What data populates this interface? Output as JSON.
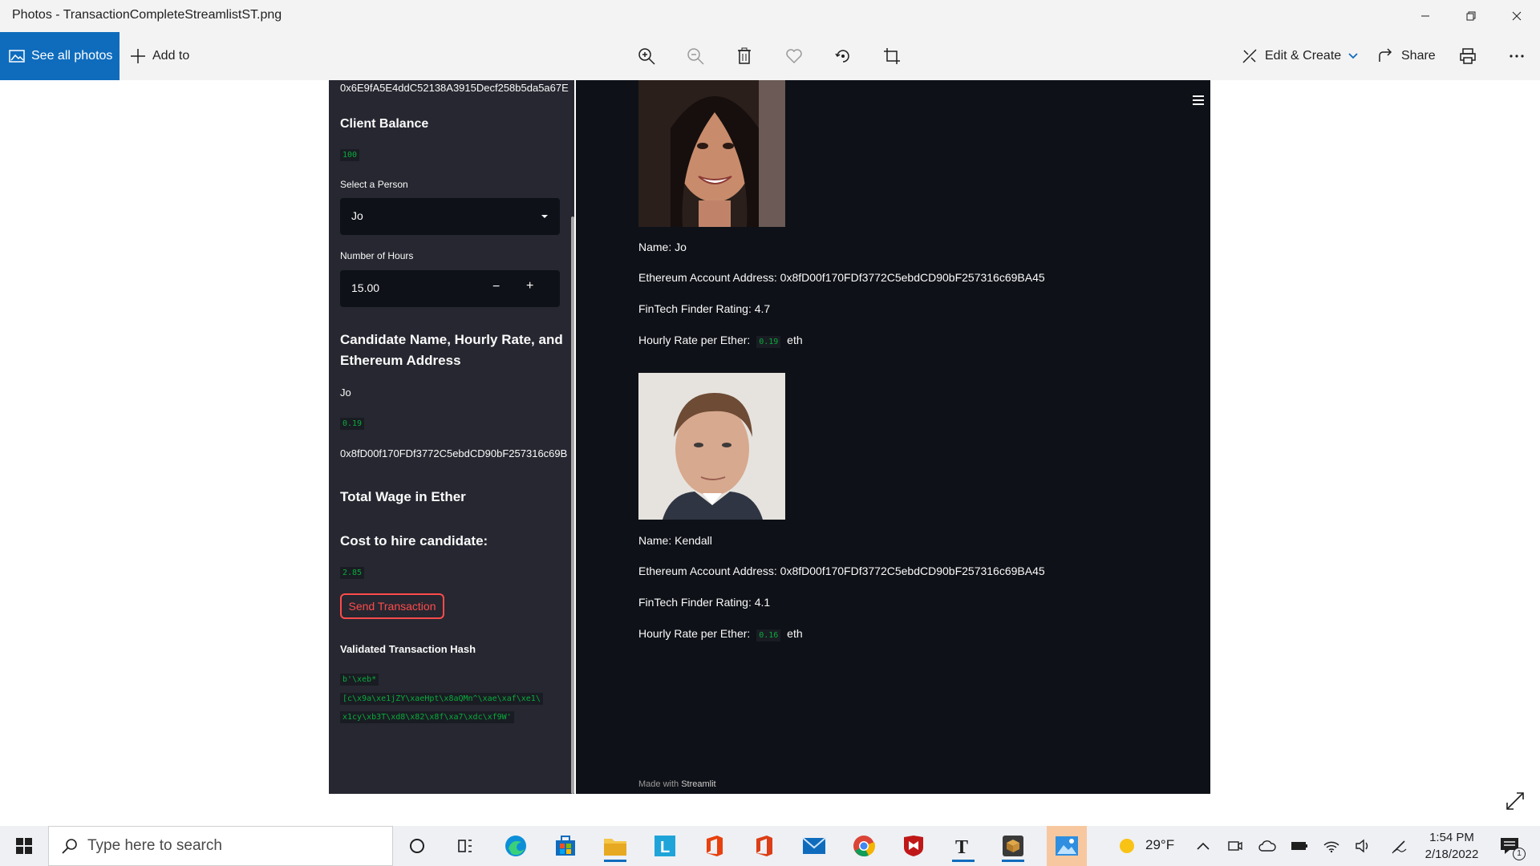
{
  "window": {
    "title": "Photos - TransactionCompleteStreamlistST.png"
  },
  "toolbar": {
    "see_all_photos": "See all photos",
    "add_to": "Add to",
    "edit_create": "Edit & Create",
    "share": "Share"
  },
  "sidebar": {
    "top_address": "0x6E9fA5E4ddC52138A3915Decf258b5da5a67E",
    "client_balance_heading": "Client Balance",
    "client_balance_value": "100",
    "select_person_label": "Select a Person",
    "select_person_value": "Jo",
    "hours_label": "Number of Hours",
    "hours_value": "15.00",
    "minus": "−",
    "plus": "+",
    "candidate_heading_1": "Candidate Name, Hourly Rate, and",
    "candidate_heading_2": "Ethereum Address",
    "candidate_name": "Jo",
    "candidate_rate": "0.19",
    "candidate_address": "0x8fD00f170FDf3772C5ebdCD90bF257316c69B",
    "total_wage_heading": "Total Wage in Ether",
    "cost_heading": "Cost to hire candidate:",
    "cost_value": "2.85",
    "send_button": "Send Transaction",
    "hash_heading": "Validated Transaction Hash",
    "hash_line1": "b'\\xeb*",
    "hash_line2": "[c\\x9a\\xe1jZY\\xaeHpt\\x8aQMn^\\xae\\xaf\\xe1\\",
    "hash_line3": "x1cy\\xb3T\\xd8\\x82\\x8f\\xa7\\xdc\\xf9W'"
  },
  "main": {
    "candidates": [
      {
        "name": "Name: Jo",
        "address": "Ethereum Account Address: 0x8fD00f170FDf3772C5ebdCD90bF257316c69BA45",
        "rating": "FinTech Finder Rating: 4.7",
        "rate_label": "Hourly Rate per Ether:",
        "rate_value": "0.19",
        "rate_unit": "eth"
      },
      {
        "name": "Name: Kendall",
        "address": "Ethereum Account Address: 0x8fD00f170FDf3772C5ebdCD90bF257316c69BA45",
        "rating": "FinTech Finder Rating: 4.1",
        "rate_label": "Hourly Rate per Ether:",
        "rate_value": "0.16",
        "rate_unit": "eth"
      }
    ],
    "footer_prefix": "Made with",
    "footer_brand": "Streamlit"
  },
  "taskbar": {
    "search_placeholder": "Type here to search",
    "temperature": "29°F",
    "time": "1:54 PM",
    "date": "2/18/2022",
    "notification_count": "1"
  },
  "icons": {
    "see_all": "photos-icon",
    "add": "plus-icon",
    "zoom_in": "zoom-in-icon",
    "zoom_out": "zoom-out-icon",
    "delete": "trash-icon",
    "favorite": "heart-icon",
    "rotate": "rotate-icon",
    "crop": "crop-icon",
    "edit": "edit-create-icon",
    "share": "share-icon",
    "print": "print-icon",
    "more": "more-icon"
  },
  "colors": {
    "accent": "#0f6cbd",
    "streamlit_red": "#ff4b4b",
    "code_green": "#09ab3b",
    "sidebar_bg": "#262730",
    "main_bg": "#0e1117"
  }
}
